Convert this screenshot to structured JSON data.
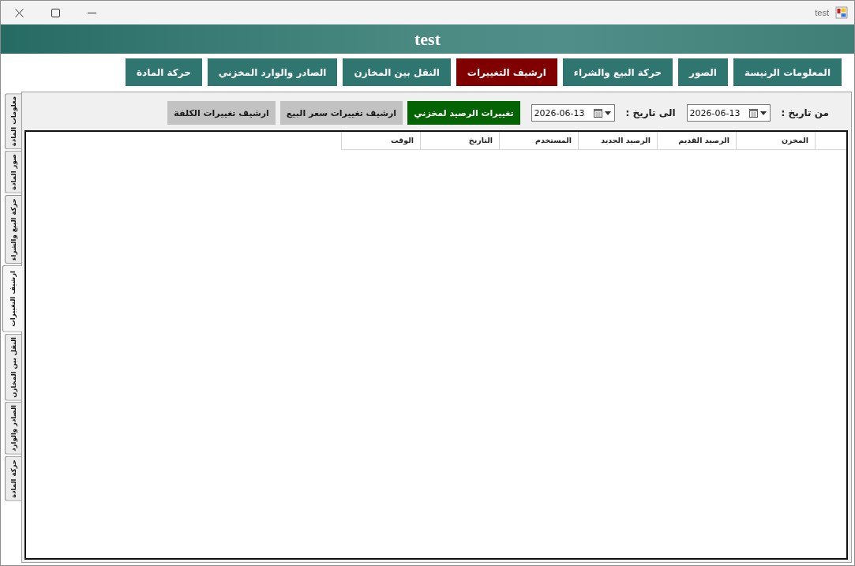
{
  "window": {
    "title": "test"
  },
  "header": {
    "title": "test"
  },
  "nav_buttons": [
    {
      "label": "المعلومات الرنيسة",
      "selected": false
    },
    {
      "label": "الصور",
      "selected": false
    },
    {
      "label": "حركة البيع والشراء",
      "selected": false
    },
    {
      "label": "ارشيف التغييرات",
      "selected": true
    },
    {
      "label": "النقل بين المخازن",
      "selected": false
    },
    {
      "label": "الصادر والوارد المخزني",
      "selected": false
    },
    {
      "label": "حركة المادة",
      "selected": false
    }
  ],
  "side_tabs": [
    {
      "label": "معلومات المادة",
      "selected": false
    },
    {
      "label": "صور المادة",
      "selected": false
    },
    {
      "label": "حركة البيع والشراء",
      "selected": false
    },
    {
      "label": "ارشيف التغييرات",
      "selected": true
    },
    {
      "label": "النقل بين المخازن",
      "selected": false
    },
    {
      "label": "الصادر والوارد",
      "selected": false
    },
    {
      "label": "حركة المادة",
      "selected": false
    }
  ],
  "filters": {
    "from_label": "من تاريخ :",
    "from_date": "2026-06-13",
    "to_label": "الى تاريخ :",
    "to_date": "2026-06-13"
  },
  "archive_buttons": [
    {
      "label": "تغييرات الرصيد لمخزني",
      "selected": true
    },
    {
      "label": "ارشيف تغييرات سعر البيع",
      "selected": false
    },
    {
      "label": "ارشيف تغييرات الكلفة",
      "selected": false
    }
  ],
  "table": {
    "columns": [
      "المخزن",
      "الرصيد القديم",
      "الرصيد الجديد",
      "المستخدم",
      "التاريخ",
      "الوقت"
    ]
  }
}
